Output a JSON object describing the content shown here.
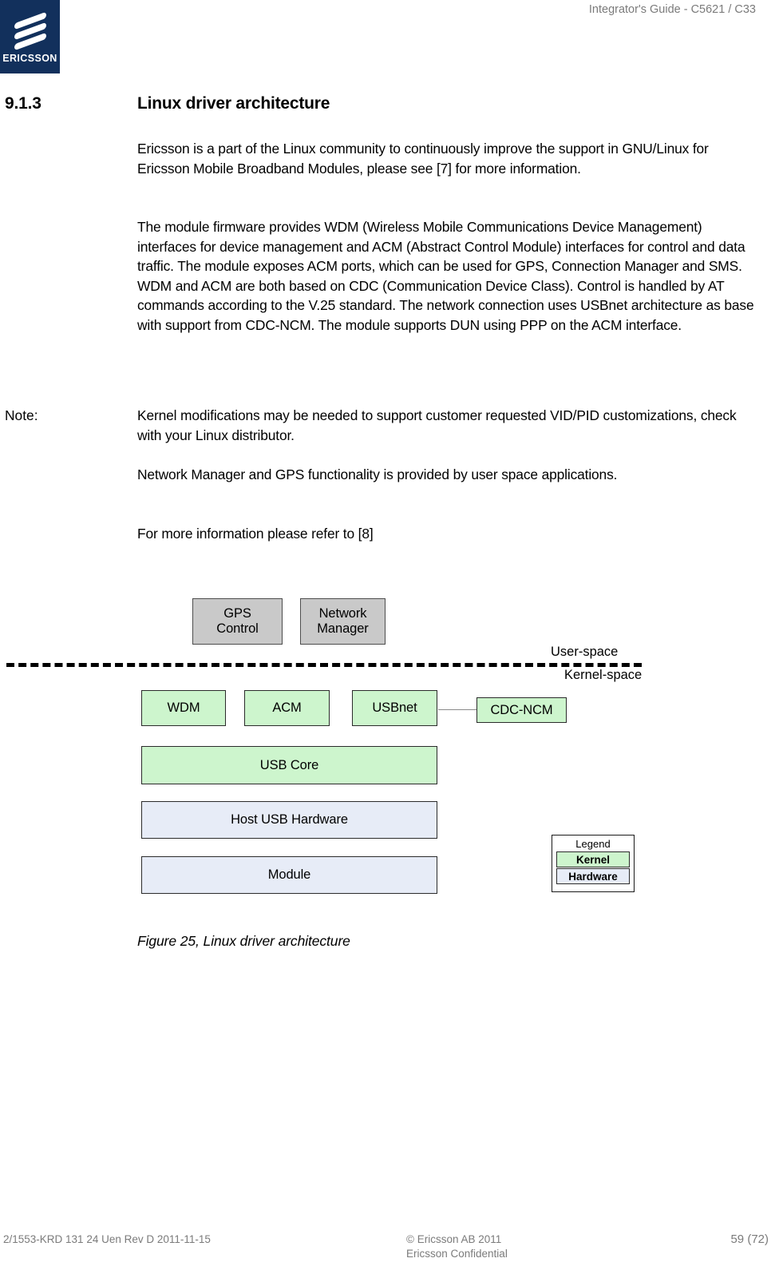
{
  "header": {
    "title": "Integrator's Guide - C5621 / C33",
    "logo_wordmark": "ERICSSON"
  },
  "section": {
    "number": "9.1.3",
    "title": "Linux driver architecture"
  },
  "body": {
    "p1": "Ericsson is a part of the Linux community to continuously improve the support in GNU/Linux for Ericsson Mobile Broadband Modules, please see [7] for more information.",
    "p2": "The module firmware provides WDM (Wireless Mobile Communications Device Management) interfaces for device management and ACM (Abstract Control Module) interfaces for control and data traffic. The module exposes ACM ports, which can be used for GPS, Connection Manager and SMS. WDM and ACM are both based on CDC (Communication Device Class). Control is handled by AT commands according to the V.25 standard. The network connection uses USBnet architecture as base with support from CDC-NCM. The module supports DUN using PPP on the ACM interface.",
    "note_label": "Note:",
    "note_text": "Kernel modifications may be needed to support customer requested VID/PID customizations, check with your Linux distributor.",
    "p3": "Network Manager and GPS functionality is provided by user space applications.",
    "p4": "For more information please refer to [8]"
  },
  "figure": {
    "caption": "Figure 25, Linux driver architecture",
    "user_space_label": "User-space",
    "kernel_space_label": "Kernel-space",
    "boxes": {
      "gps_control": "GPS\nControl",
      "gps_control_line1": "GPS",
      "gps_control_line2": "Control",
      "network_manager_line1": "Network",
      "network_manager_line2": "Manager",
      "wdm": "WDM",
      "acm": "ACM",
      "usbnet": "USBnet",
      "cdc_ncm": "CDC-NCM",
      "usb_core": "USB Core",
      "host_usb_hardware": "Host USB Hardware",
      "module": "Module"
    },
    "legend": {
      "title": "Legend",
      "kernel": "Kernel",
      "hardware": "Hardware"
    },
    "colors": {
      "user_space_fill": "#c9c9c9",
      "kernel_fill": "#cdf5cd",
      "hardware_fill": "#e7ecf7",
      "border": "#2b2b2b"
    }
  },
  "footer": {
    "doc_id": "2/1553-KRD 131 24 Uen  Rev D    2011-11-15",
    "copyright_line1": "© Ericsson AB 2011",
    "copyright_line2": "Ericsson Confidential",
    "page": "59 (72)"
  }
}
